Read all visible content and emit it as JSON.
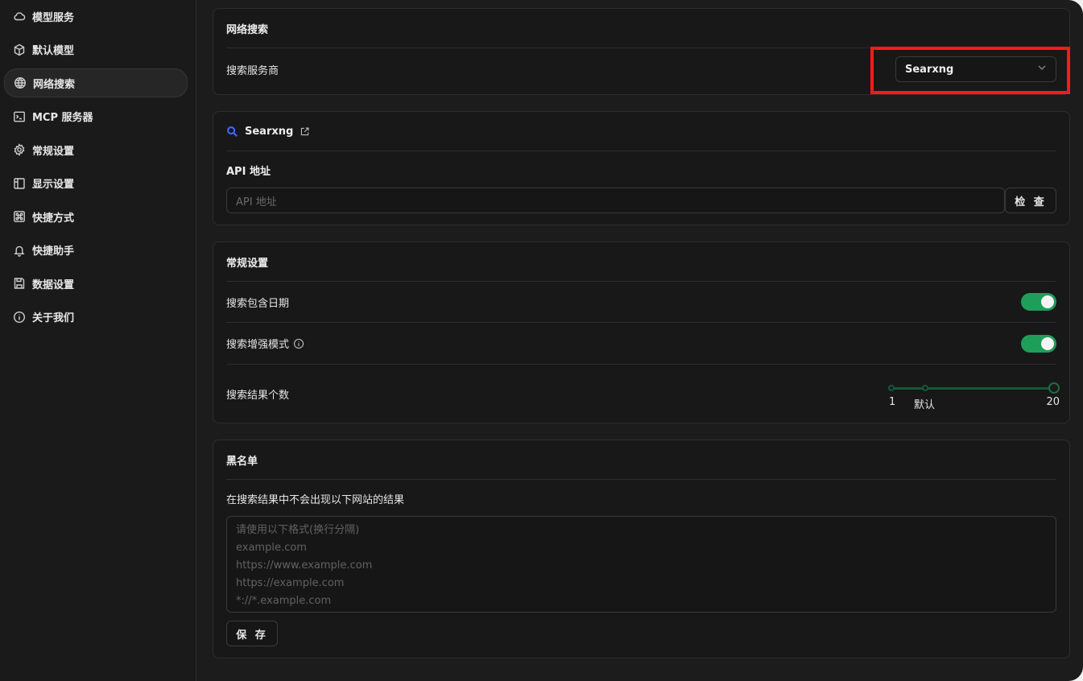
{
  "sidebar": {
    "items": [
      {
        "label": "模型服务",
        "icon": "cloud-icon"
      },
      {
        "label": "默认模型",
        "icon": "cube-icon"
      },
      {
        "label": "网络搜索",
        "icon": "globe-icon"
      },
      {
        "label": "MCP 服务器",
        "icon": "terminal-icon"
      },
      {
        "label": "常规设置",
        "icon": "gear-icon"
      },
      {
        "label": "显示设置",
        "icon": "layout-icon"
      },
      {
        "label": "快捷方式",
        "icon": "command-icon"
      },
      {
        "label": "快捷助手",
        "icon": "bell-icon"
      },
      {
        "label": "数据设置",
        "icon": "save-icon"
      },
      {
        "label": "关于我们",
        "icon": "info-icon"
      }
    ],
    "active": "网络搜索"
  },
  "web_search": {
    "title": "网络搜索",
    "provider_label": "搜索服务商",
    "provider_value": "Searxng"
  },
  "provider": {
    "name": "Searxng",
    "api_label": "API 地址",
    "api_placeholder": "API 地址",
    "check_button": "检 查"
  },
  "general": {
    "title": "常规设置",
    "include_date_label": "搜索包含日期",
    "include_date_on": true,
    "enhance_label": "搜索增强模式",
    "enhance_on": true,
    "result_count_label": "搜索结果个数",
    "slider_min": "1",
    "slider_default": "默认",
    "slider_max": "20",
    "slider_value": 20
  },
  "blacklist": {
    "title": "黑名单",
    "description": "在搜索结果中不会出现以下网站的结果",
    "placeholder_lines": [
      "请使用以下格式(换行分隔)",
      "example.com",
      "https://www.example.com",
      "https://example.com",
      "*://*.example.com"
    ],
    "save_button": "保 存"
  },
  "colors": {
    "accent_green": "#1f9e5a",
    "highlight_red": "#ff1a1a",
    "search_icon_blue": "#3d6bff"
  }
}
